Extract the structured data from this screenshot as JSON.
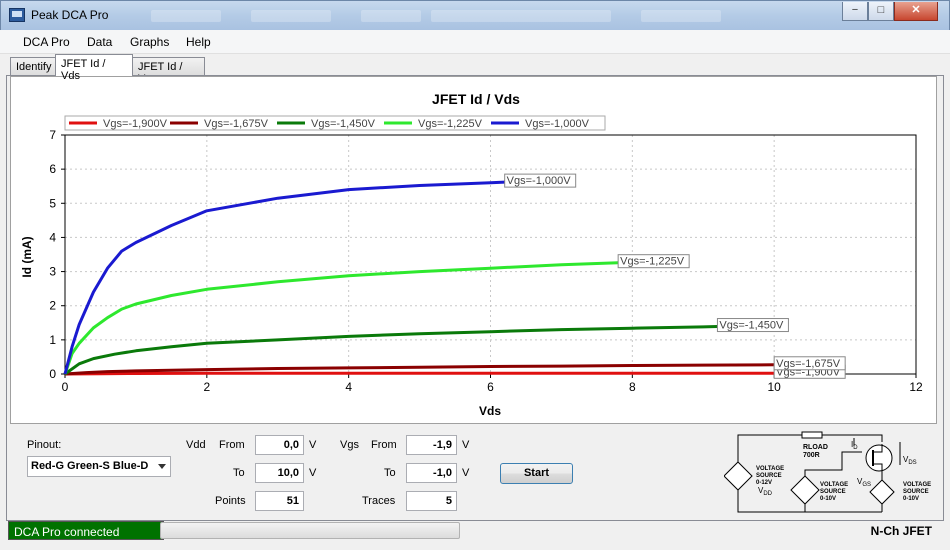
{
  "window": {
    "title": "Peak DCA Pro",
    "minimize": "−",
    "maximize": "□",
    "close": "✕"
  },
  "menu": [
    "DCA Pro",
    "Data",
    "Graphs",
    "Help"
  ],
  "tabs": [
    "Identify",
    "JFET Id / Vds",
    "JFET Id / Vgs"
  ],
  "active_tab": "JFET Id / Vds",
  "chart_data": {
    "type": "line",
    "title": "JFET Id / Vds",
    "xlabel": "Vds",
    "ylabel": "Id (mA)",
    "xlim": [
      0,
      12
    ],
    "ylim": [
      0,
      7
    ],
    "xticks": [
      0,
      2,
      4,
      6,
      8,
      10,
      12
    ],
    "yticks": [
      0,
      1,
      2,
      3,
      4,
      5,
      6,
      7
    ],
    "grid": true,
    "legend_placement": "top-left",
    "series": [
      {
        "name": "Vgs=-1,900V",
        "color": "#e01010",
        "x": [
          0,
          0.5,
          1,
          2,
          4,
          6,
          8,
          10
        ],
        "y": [
          0,
          0.01,
          0.015,
          0.02,
          0.02,
          0.02,
          0.02,
          0.02
        ]
      },
      {
        "name": "Vgs=-1,675V",
        "color": "#8b0000",
        "x": [
          0,
          0.3,
          0.6,
          1,
          1.5,
          2,
          3,
          4,
          5,
          6,
          7,
          8,
          9,
          10
        ],
        "y": [
          0,
          0.04,
          0.07,
          0.09,
          0.11,
          0.13,
          0.16,
          0.18,
          0.2,
          0.22,
          0.23,
          0.25,
          0.26,
          0.27
        ]
      },
      {
        "name": "Vgs=-1,450V",
        "color": "#0a7a0a",
        "x": [
          0,
          0.2,
          0.4,
          0.7,
          1,
          1.5,
          2,
          3,
          4,
          5,
          6,
          7,
          8,
          9,
          9.2
        ],
        "y": [
          0,
          0.3,
          0.45,
          0.58,
          0.68,
          0.8,
          0.9,
          1.0,
          1.1,
          1.18,
          1.24,
          1.3,
          1.34,
          1.38,
          1.39
        ]
      },
      {
        "name": "Vgs=-1,225V",
        "color": "#2ee82e",
        "x": [
          0,
          0.1,
          0.2,
          0.4,
          0.6,
          0.8,
          1,
          1.5,
          2,
          3,
          4,
          5,
          6,
          7,
          7.8
        ],
        "y": [
          0,
          0.6,
          0.9,
          1.35,
          1.65,
          1.9,
          2.05,
          2.3,
          2.48,
          2.7,
          2.88,
          3.0,
          3.1,
          3.2,
          3.26
        ]
      },
      {
        "name": "Vgs=-1,000V",
        "color": "#1a1ad0",
        "x": [
          0,
          0.1,
          0.2,
          0.4,
          0.6,
          0.8,
          1,
          1.5,
          2,
          3,
          4,
          5,
          6,
          6.2
        ],
        "y": [
          0,
          0.8,
          1.45,
          2.4,
          3.1,
          3.6,
          3.85,
          4.35,
          4.78,
          5.15,
          5.4,
          5.52,
          5.6,
          5.62
        ]
      }
    ]
  },
  "form": {
    "pinout_label": "Pinout:",
    "pinout_value": "Red-G Green-S Blue-D",
    "vdd_label": "Vdd",
    "from_label": "From",
    "to_label": "To",
    "points_label": "Points",
    "vdd_from": "0,0",
    "vdd_to": "10,0",
    "points": "51",
    "unit_v": "V",
    "vgs_label": "Vgs",
    "vgs_from": "-1,9",
    "vgs_to": "-1,0",
    "traces_label": "Traces",
    "traces": "5",
    "start_label": "Start"
  },
  "schematic": {
    "rload": "RLOAD",
    "rload_value": "700R",
    "id": "I",
    "id_sub": "D",
    "vds": "V",
    "vds_sub": "DS",
    "vgs": "V",
    "vgs_sub": "GS",
    "vdd": "V",
    "vdd_sub": "DD",
    "src1": [
      "VOLTAGE",
      "SOURCE",
      "0-12V"
    ],
    "src2": [
      "VOLTAGE",
      "SOURCE",
      "0-10V"
    ],
    "src3": [
      "VOLTAGE",
      "SOURCE",
      "0-10V"
    ]
  },
  "status": {
    "connection": "DCA Pro connected",
    "device_type": "N-Ch JFET",
    "progress_percent": 0
  }
}
